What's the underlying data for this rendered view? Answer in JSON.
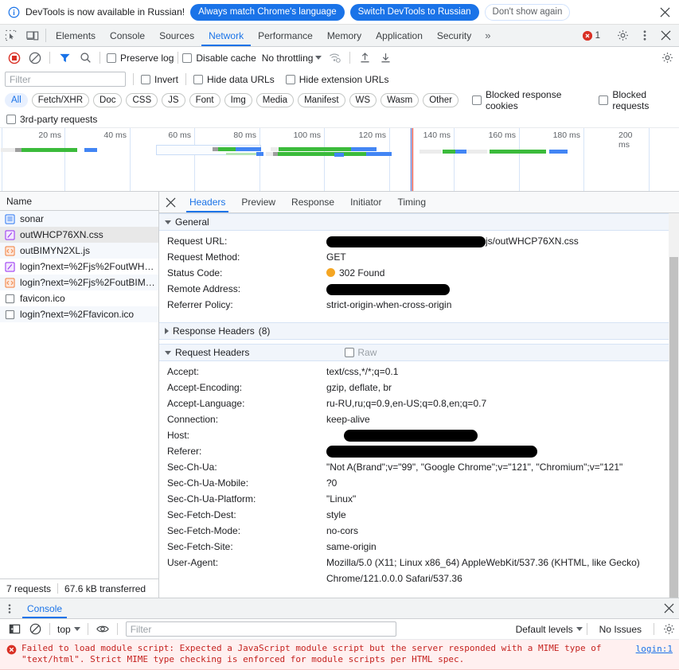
{
  "banner": {
    "icon": "info-icon",
    "message": "DevTools is now available in Russian!",
    "btn_always": "Always match Chrome's language",
    "btn_switch": "Switch DevTools to Russian",
    "btn_dismiss": "Don't show again",
    "close": "✕"
  },
  "tabbar": {
    "inspect_icon": "inspect-element-icon",
    "device_icon": "device-toolbar-icon",
    "tabs": [
      {
        "label": "Elements",
        "active": false
      },
      {
        "label": "Console",
        "active": false
      },
      {
        "label": "Sources",
        "active": false
      },
      {
        "label": "Network",
        "active": true
      },
      {
        "label": "Performance",
        "active": false
      },
      {
        "label": "Memory",
        "active": false
      },
      {
        "label": "Application",
        "active": false
      },
      {
        "label": "Security",
        "active": false
      }
    ],
    "more": "»",
    "error_count": "1",
    "settings_icon": "gear-icon",
    "menu_icon": "kebab-menu-icon",
    "close_icon": "close-icon"
  },
  "network_toolbar": {
    "record_icon": "record-stop-icon",
    "clear_icon": "clear-icon",
    "filter_icon": "funnel-filter-icon",
    "search_icon": "search-icon",
    "preserve_log": "Preserve log",
    "disable_cache": "Disable cache",
    "throttling": "No throttling",
    "wifi_icon": "network-conditions-icon",
    "import_icon": "import-har-icon",
    "export_icon": "export-har-icon",
    "settings_icon": "gear-icon"
  },
  "filter_row": {
    "placeholder": "Filter",
    "value": "",
    "invert": "Invert",
    "hide_data_urls": "Hide data URLs",
    "hide_extension_urls": "Hide extension URLs"
  },
  "type_chips": [
    {
      "label": "All",
      "active": true
    },
    {
      "label": "Fetch/XHR",
      "active": false
    },
    {
      "label": "Doc",
      "active": false
    },
    {
      "label": "CSS",
      "active": false
    },
    {
      "label": "JS",
      "active": false
    },
    {
      "label": "Font",
      "active": false
    },
    {
      "label": "Img",
      "active": false
    },
    {
      "label": "Media",
      "active": false
    },
    {
      "label": "Manifest",
      "active": false
    },
    {
      "label": "WS",
      "active": false
    },
    {
      "label": "Wasm",
      "active": false
    },
    {
      "label": "Other",
      "active": false
    }
  ],
  "chip_checkboxes": [
    {
      "label": "Blocked response cookies"
    },
    {
      "label": "Blocked requests"
    }
  ],
  "third_party": "3rd-party requests",
  "overview": {
    "ticks": [
      "20 ms",
      "40 ms",
      "60 ms",
      "80 ms",
      "100 ms",
      "120 ms",
      "140 ms",
      "160 ms",
      "180 ms",
      "200 ms"
    ],
    "unit": "ms",
    "max_ms": 210
  },
  "request_list": {
    "column_header": "Name",
    "rows": [
      {
        "name": "sonar",
        "icon": "document-icon",
        "selected": false
      },
      {
        "name": "outWHCP76XN.css",
        "icon": "stylesheet-icon",
        "selected": true
      },
      {
        "name": "outBIMYN2XL.js",
        "icon": "script-icon",
        "selected": false
      },
      {
        "name": "login?next=%2Fjs%2FoutWH…",
        "icon": "stylesheet-icon",
        "selected": false
      },
      {
        "name": "login?next=%2Fjs%2FoutBIM…",
        "icon": "script-icon",
        "selected": false
      },
      {
        "name": "favicon.ico",
        "icon": "generic-file-icon",
        "selected": false
      },
      {
        "name": "login?next=%2Ffavicon.ico",
        "icon": "generic-file-icon",
        "selected": false
      }
    ]
  },
  "status_bar": {
    "requests": "7 requests",
    "transferred": "67.6 kB transferred"
  },
  "detail": {
    "close_icon": "close-icon",
    "tabs": [
      {
        "label": "Headers",
        "active": true
      },
      {
        "label": "Preview",
        "active": false
      },
      {
        "label": "Response",
        "active": false
      },
      {
        "label": "Initiator",
        "active": false
      },
      {
        "label": "Timing",
        "active": false
      }
    ],
    "general": {
      "title": "General",
      "expanded": true,
      "rows": [
        {
          "key": "Request URL:",
          "value": "js/outWHCP76XN.css",
          "redacted": true,
          "redact_width": 200,
          "status": null
        },
        {
          "key": "Request Method:",
          "value": "GET",
          "redacted": false,
          "status": null
        },
        {
          "key": "Status Code:",
          "value": "302 Found",
          "redacted": false,
          "status": "302"
        },
        {
          "key": "Remote Address:",
          "value": "",
          "redacted": true,
          "redact_width": 155,
          "status": null
        },
        {
          "key": "Referrer Policy:",
          "value": "strict-origin-when-cross-origin",
          "redacted": false,
          "status": null
        }
      ]
    },
    "response_headers": {
      "title": "Response Headers",
      "count": "(8)",
      "expanded": false
    },
    "request_headers": {
      "title": "Request Headers",
      "expanded": true,
      "raw_label": "Raw",
      "rows": [
        {
          "key": "Accept:",
          "value": "text/css,*/*;q=0.1",
          "redacted": false
        },
        {
          "key": "Accept-Encoding:",
          "value": "gzip, deflate, br",
          "redacted": false
        },
        {
          "key": "Accept-Language:",
          "value": "ru-RU,ru;q=0.9,en-US;q=0.8,en;q=0.7",
          "redacted": false
        },
        {
          "key": "Connection:",
          "value": "keep-alive",
          "redacted": false
        },
        {
          "key": "Host:",
          "value": "",
          "redacted": true,
          "redact_width": 168,
          "redact_offset": 22
        },
        {
          "key": "Referer:",
          "value": "",
          "redacted": true,
          "redact_width": 265,
          "redact_offset": 0
        },
        {
          "key": "Sec-Ch-Ua:",
          "value": "\"Not A(Brand\";v=\"99\", \"Google Chrome\";v=\"121\", \"Chromium\";v=\"121\"",
          "redacted": false
        },
        {
          "key": "Sec-Ch-Ua-Mobile:",
          "value": "?0",
          "redacted": false
        },
        {
          "key": "Sec-Ch-Ua-Platform:",
          "value": "\"Linux\"",
          "redacted": false
        },
        {
          "key": "Sec-Fetch-Dest:",
          "value": "style",
          "redacted": false
        },
        {
          "key": "Sec-Fetch-Mode:",
          "value": "no-cors",
          "redacted": false
        },
        {
          "key": "Sec-Fetch-Site:",
          "value": "same-origin",
          "redacted": false
        },
        {
          "key": "User-Agent:",
          "value": "Mozilla/5.0 (X11; Linux x86_64) AppleWebKit/537.36 (KHTML, like Gecko) Chrome/121.0.0.0 Safari/537.36",
          "redacted": false
        }
      ]
    }
  },
  "console_drawer": {
    "menu_icon": "kebab-menu-icon",
    "tab_label": "Console",
    "close_icon": "close-icon",
    "sidebar_icon": "console-sidebar-icon",
    "clear_icon": "clear-console-icon",
    "context": "top",
    "eye_icon": "live-expression-icon",
    "filter_placeholder": "Filter",
    "filter_value": "",
    "levels": "Default levels",
    "issues": "No Issues",
    "settings_icon": "gear-icon",
    "messages": [
      {
        "level": "error",
        "icon": "error-icon",
        "text": "Failed to load module script: Expected a JavaScript module script but the server responded with a MIME type of\n\"text/html\". Strict MIME type checking is enforced for module scripts per HTML spec.",
        "source": "login:1"
      }
    ]
  },
  "colors": {
    "accent": "#1a73e8",
    "error": "#d93025",
    "error_text": "#c5221f",
    "warn_dot": "#f5a623",
    "chip_active_bg": "#e8f0fe",
    "toolbar_bg": "#f1f3f4",
    "section_bg": "#f1f5fb"
  },
  "chart_data": {
    "type": "timeline",
    "title": "Network request timeline overview",
    "xlabel": "ms",
    "xlim": [
      0,
      210
    ],
    "tick_values": [
      20,
      40,
      60,
      80,
      100,
      120,
      140,
      160,
      180,
      200
    ],
    "tick_labels": [
      "20 ms",
      "40 ms",
      "60 ms",
      "80 ms",
      "100 ms",
      "120 ms",
      "140 ms",
      "160 ms",
      "180 ms",
      "200 ms"
    ],
    "markers": [
      {
        "name": "DOMContentLoaded",
        "ms": 130,
        "color": "#4050b5"
      },
      {
        "name": "Load",
        "ms": 131,
        "color": "#d93025"
      }
    ],
    "series": [
      {
        "name": "sonar",
        "segments": [
          {
            "phase": "waiting",
            "start_ms": 1,
            "end_ms": 10,
            "color": "#ececec"
          },
          {
            "phase": "stalled",
            "start_ms": 10,
            "end_ms": 13,
            "color": "#9e9e9e"
          },
          {
            "phase": "download",
            "start_ms": 13,
            "end_ms": 48,
            "color": "#3bbb3b"
          },
          {
            "phase": "idle",
            "start_ms": 48,
            "end_ms": 54,
            "color": "#ffffff"
          },
          {
            "phase": "blue",
            "start_ms": 54,
            "end_ms": 62,
            "color": "#4285f4"
          }
        ]
      },
      {
        "name": "outWHCP76XN.css",
        "segments": [
          {
            "phase": "queued",
            "start_ms": 88,
            "end_ms": 123,
            "color": "#fbfdff"
          },
          {
            "phase": "stalled",
            "start_ms": 123,
            "end_ms": 125,
            "color": "#9e9e9e"
          },
          {
            "phase": "download",
            "start_ms": 125,
            "end_ms": 132,
            "color": "#3bbb3b"
          },
          {
            "phase": "blue",
            "start_ms": 132,
            "end_ms": 148,
            "color": "#4285f4"
          }
        ]
      },
      {
        "name": "outBIMYN2XL.js",
        "segments": [
          {
            "phase": "waiting",
            "start_ms": 146,
            "end_ms": 151,
            "color": "#ececec"
          },
          {
            "phase": "stalled",
            "start_ms": 151,
            "end_ms": 154,
            "color": "#9e9e9e"
          },
          {
            "phase": "download",
            "start_ms": 154,
            "end_ms": 196,
            "color": "#3bbb3b"
          },
          {
            "phase": "blue",
            "start_ms": 196,
            "end_ms": 218,
            "color": "#4285f4"
          }
        ]
      },
      {
        "name": "favicon.ico",
        "segments": [
          {
            "phase": "waiting",
            "start_ms": 249,
            "end_ms": 260,
            "color": "#ececec"
          },
          {
            "phase": "download",
            "start_ms": 261,
            "end_ms": 271,
            "color": "#3bbb3b"
          },
          {
            "phase": "blue",
            "start_ms": 272,
            "end_ms": 280,
            "color": "#4285f4"
          },
          {
            "phase": "waiting2",
            "start_ms": 280,
            "end_ms": 296,
            "color": "#ececec"
          },
          {
            "phase": "download2",
            "start_ms": 298,
            "end_ms": 352,
            "color": "#3bbb3b"
          },
          {
            "phase": "blue2",
            "start_ms": 353,
            "end_ms": 364,
            "color": "#4285f4"
          }
        ]
      }
    ]
  }
}
